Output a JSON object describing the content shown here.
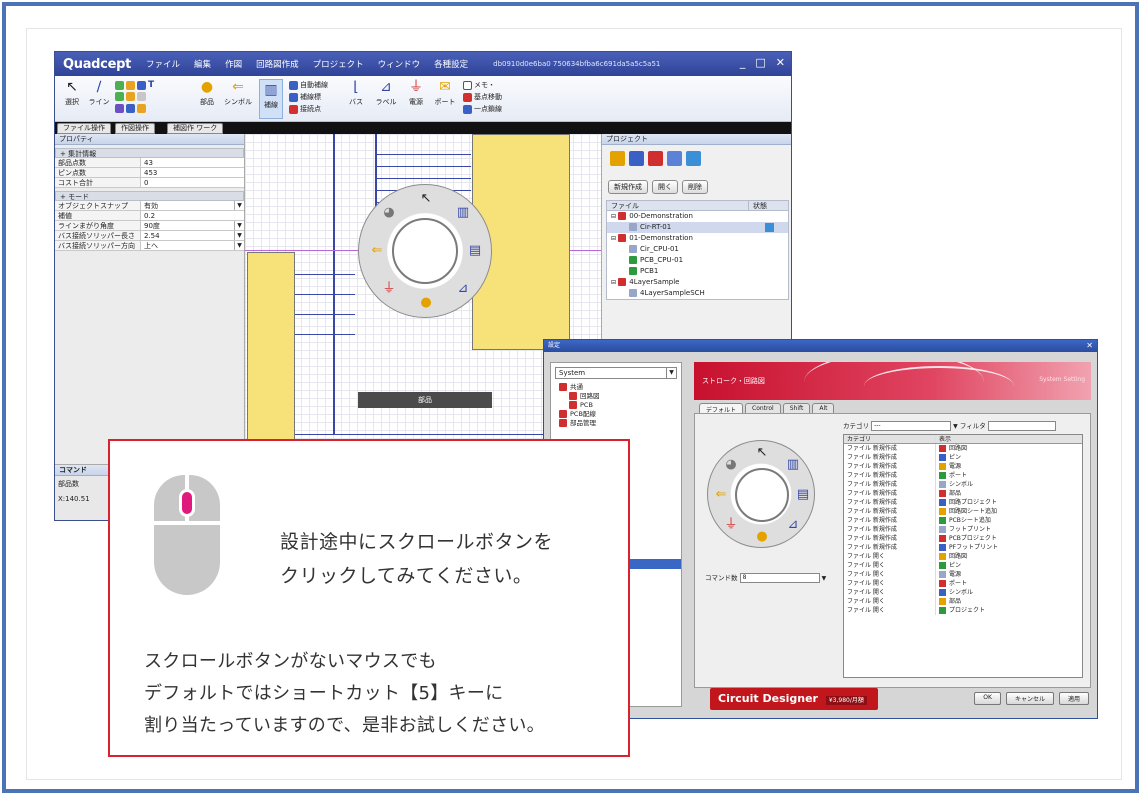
{
  "app": {
    "logo": "Quadcept",
    "menu": [
      "ファイル",
      "編集",
      "作図",
      "回路図作成",
      "プロジェクト",
      "ウィンドウ",
      "各種設定"
    ],
    "doc_id": "db0910d0e6ba0 750634bfba6c691da5a5c5a51",
    "window_buttons": [
      "_",
      "□",
      "✕"
    ]
  },
  "ribbon": {
    "buttons": [
      "選択",
      "ライン",
      "部品",
      "シンボル",
      "補線",
      "バス",
      "ラベル",
      "電源",
      "ポート"
    ],
    "small_items": [
      "自動補線",
      "補線標",
      "接続点",
      "メモ・",
      "基点移動",
      "一点鎖線"
    ]
  },
  "doc_tabs": [
    "ファイル操作",
    "作図操作",
    "補図作 ワーク"
  ],
  "property_panel": {
    "title": "プロパティ",
    "group1": "+ 集計情報",
    "rows1": [
      {
        "k": "部品点数",
        "v": "43"
      },
      {
        "k": "ピン点数",
        "v": "453"
      },
      {
        "k": "コスト合計",
        "v": "0"
      }
    ],
    "group2": "+ モード",
    "rows2": [
      {
        "k": "オブジェクトスナップ",
        "v": "有効"
      },
      {
        "k": "補値",
        "v": "0.2"
      },
      {
        "k": "ラインまがり角度",
        "v": "90度"
      },
      {
        "k": "バス接続ソリッパー長さ",
        "v": "2.54"
      },
      {
        "k": "バス接続ソリッパー方向",
        "v": "上へ"
      }
    ],
    "cmd_label": "コマンド",
    "cmd_field": "部品数",
    "coord": "X:140.51"
  },
  "canvas": {
    "context_label": "部品"
  },
  "project_panel": {
    "title": "プロジェクト",
    "buttons": [
      "新規作成",
      "開く",
      "削除"
    ],
    "col_file": "ファイル",
    "col_state": "状態",
    "tree": [
      "00-Demonstration",
      "Cir-RT-01",
      "01-Demonstration",
      "Cir_CPU-01",
      "PCB_CPU-01",
      "PCB1",
      "4LayerSample",
      "4LayerSampleSCH"
    ]
  },
  "settings_dialog": {
    "title": "設定",
    "system_select": "System",
    "tree": [
      "共通",
      "回路図",
      "PCB",
      "PCB配線",
      "部品管理"
    ],
    "banner_title": "ストローク・回路図",
    "banner_right": "System Setting",
    "tabs": [
      "デフォルト",
      "Control",
      "Shift",
      "Alt"
    ],
    "category_label": "カテゴリ",
    "category_value": "---",
    "filter_label": "フィルタ",
    "command_label": "コマンド数",
    "command_value": "8",
    "list_headers": [
      "カテゴリ",
      "表示"
    ],
    "list_rows": [
      [
        "ファイル 新規作成",
        "回路図"
      ],
      [
        "ファイル 新規作成",
        "ピン"
      ],
      [
        "ファイル 新規作成",
        "電源"
      ],
      [
        "ファイル 新規作成",
        "ポート"
      ],
      [
        "ファイル 新規作成",
        "シンボル"
      ],
      [
        "ファイル 新規作成",
        "部品"
      ],
      [
        "ファイル 新規作成",
        "回路プロジェクト"
      ],
      [
        "ファイル 新規作成",
        "回路図シート追加"
      ],
      [
        "ファイル 新規作成",
        "PCBシート追加"
      ],
      [
        "ファイル 新規作成",
        "フットプリント"
      ],
      [
        "ファイル 新規作成",
        "PCBプロジェクト"
      ],
      [
        "ファイル 新規作成",
        "PFフットプリント"
      ],
      [
        "ファイル 開く",
        "回路図"
      ],
      [
        "ファイル 開く",
        "ピン"
      ],
      [
        "ファイル 開く",
        "電源"
      ],
      [
        "ファイル 開く",
        "ポート"
      ],
      [
        "ファイル 開く",
        "シンボル"
      ],
      [
        "ファイル 開く",
        "部品"
      ],
      [
        "ファイル 開く",
        "プロジェクト"
      ]
    ],
    "badge": "Circuit Designer",
    "badge_price": "¥3,980/月額",
    "buttons": [
      "OK",
      "キャンセル",
      "適用"
    ]
  },
  "callout": {
    "line1": "設計途中にスクロールボタンを",
    "line2": "クリックしてみてください。",
    "note1": "スクロールボタンがないマウスでも",
    "note2": "デフォルトではショートカット【5】キーに",
    "note3": "割り当たっていますので、是非お試しください。"
  },
  "colors": {
    "frame_border": "#4a74b5",
    "callout_border": "#d9222e",
    "scroll_button": "#e0197d",
    "title_bar": "#2f4397",
    "badge": "#c2161d"
  }
}
